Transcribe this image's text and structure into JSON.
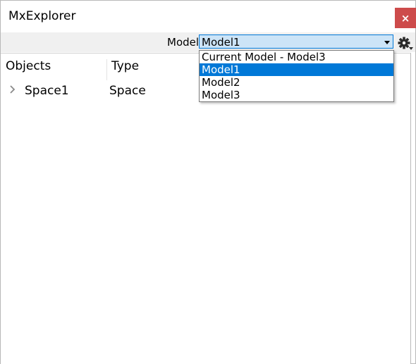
{
  "window": {
    "title": "MxExplorer",
    "close_symbol": "×"
  },
  "toolbar": {
    "model_label": "Model",
    "selected_model": "Model1",
    "settings_icon": "gear-icon"
  },
  "dropdown": {
    "options": [
      "Current Model - Model3",
      "Model1",
      "Model2",
      "Model3"
    ],
    "selected_index": 1
  },
  "tree": {
    "columns": [
      "Objects",
      "Type"
    ],
    "rows": [
      {
        "name": "Space1",
        "type": "Space",
        "expander_icon": "chevron-right-icon"
      }
    ]
  },
  "colors": {
    "accent": "#0078d7",
    "close": "#cd4b4b",
    "combo_bg": "#cce4f7"
  }
}
